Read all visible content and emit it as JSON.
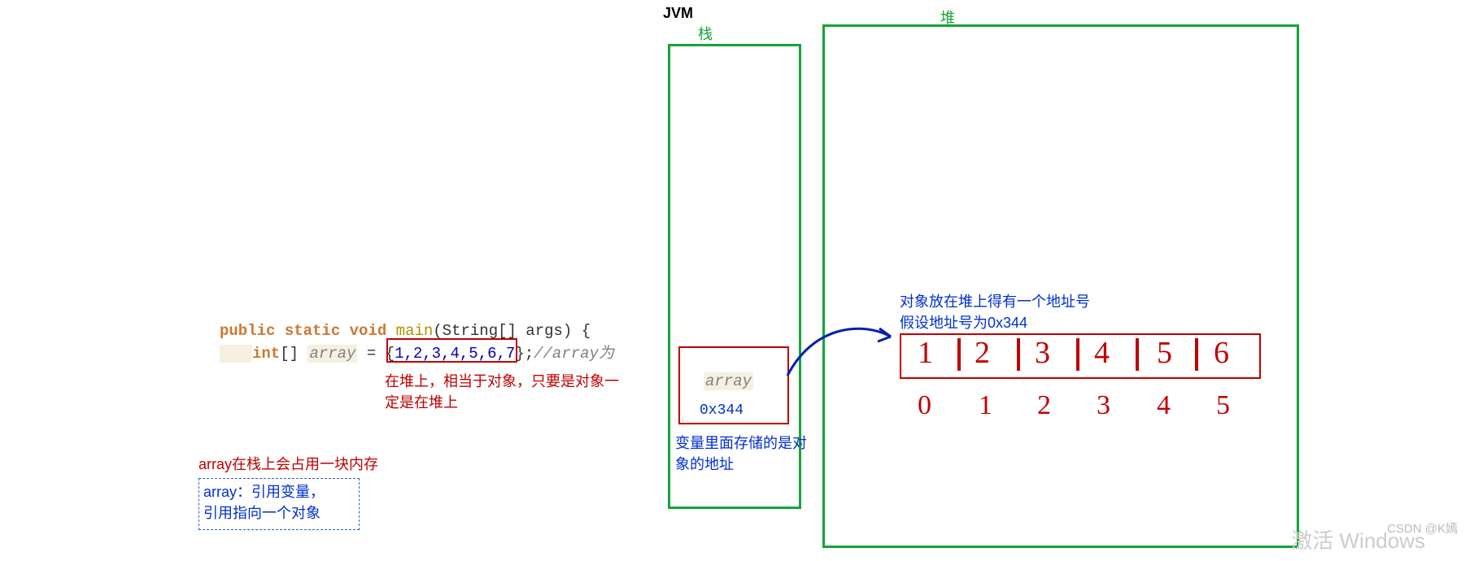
{
  "jvm_label": "JVM",
  "stack_label": "栈",
  "heap_label": "堆",
  "code": {
    "public": "public",
    "static": "static",
    "void": "void",
    "main": "main",
    "sig_open": "(String[] args) {",
    "int": "int",
    "brackets": "[] ",
    "array": "array",
    "eq": " = ",
    "brace_open": "{",
    "vals": "1,2,3,4,5,6,7",
    "brace_close": "}",
    "semi": ";",
    "comment": "//array为"
  },
  "note_heap": "在堆上，相当于对象，只要是对象一定是在堆上",
  "note_stack_mem": "array在栈上会占用一块内存",
  "note_ref1": "array：引用变量，",
  "note_ref2": "引用指向一个对象",
  "stack_var": "array",
  "stack_addr": "0x344",
  "note_store": "变量里面存储的是对象的地址",
  "note_obj1": "对象放在堆上得有一个地址号",
  "note_obj2": "假设地址号为0x344",
  "cells": [
    "1",
    "2",
    "3",
    "4",
    "5",
    "6"
  ],
  "indices": [
    "0",
    "1",
    "2",
    "3",
    "4",
    "5"
  ],
  "watermark": "激活 Windows",
  "csdn": "CSDN @K嫣"
}
